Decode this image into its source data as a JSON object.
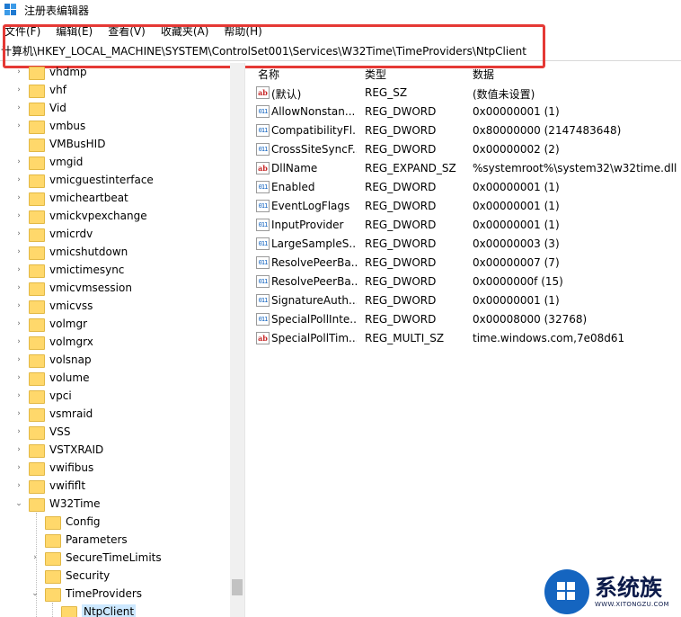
{
  "window": {
    "title": "注册表编辑器"
  },
  "menu": [
    "文件(F)",
    "编辑(E)",
    "查看(V)",
    "收藏夹(A)",
    "帮助(H)"
  ],
  "address": {
    "path": "计算机\\HKEY_LOCAL_MACHINE\\SYSTEM\\ControlSet001\\Services\\W32Time\\TimeProviders\\NtpClient"
  },
  "tree": {
    "items": [
      {
        "label": "vhdmp",
        "expander": "›"
      },
      {
        "label": "vhf",
        "expander": "›"
      },
      {
        "label": "Vid",
        "expander": "›"
      },
      {
        "label": "vmbus",
        "expander": "›"
      },
      {
        "label": "VMBusHID",
        "expander": ""
      },
      {
        "label": "vmgid",
        "expander": "›"
      },
      {
        "label": "vmicguestinterface",
        "expander": "›"
      },
      {
        "label": "vmicheartbeat",
        "expander": "›"
      },
      {
        "label": "vmickvpexchange",
        "expander": "›"
      },
      {
        "label": "vmicrdv",
        "expander": "›"
      },
      {
        "label": "vmicshutdown",
        "expander": "›"
      },
      {
        "label": "vmictimesync",
        "expander": "›"
      },
      {
        "label": "vmicvmsession",
        "expander": "›"
      },
      {
        "label": "vmicvss",
        "expander": "›"
      },
      {
        "label": "volmgr",
        "expander": "›"
      },
      {
        "label": "volmgrx",
        "expander": "›"
      },
      {
        "label": "volsnap",
        "expander": "›"
      },
      {
        "label": "volume",
        "expander": "›"
      },
      {
        "label": "vpci",
        "expander": "›"
      },
      {
        "label": "vsmraid",
        "expander": "›"
      },
      {
        "label": "VSS",
        "expander": "›"
      },
      {
        "label": "VSTXRAID",
        "expander": "›"
      },
      {
        "label": "vwifibus",
        "expander": "›"
      },
      {
        "label": "vwififlt",
        "expander": "›"
      },
      {
        "label": "W32Time",
        "expander": "⌄"
      },
      {
        "label": "Config",
        "expander": ""
      },
      {
        "label": "Parameters",
        "expander": ""
      },
      {
        "label": "SecureTimeLimits",
        "expander": "›"
      },
      {
        "label": "Security",
        "expander": ""
      },
      {
        "label": "TimeProviders",
        "expander": "⌄"
      },
      {
        "label": "NtpClient",
        "expander": ""
      }
    ]
  },
  "list": {
    "columns": {
      "name": "名称",
      "type": "类型",
      "data": "数据"
    },
    "rows": [
      {
        "name": "(默认)",
        "type": "REG_SZ",
        "data": "(数值未设置)",
        "icon": "ab"
      },
      {
        "name": "AllowNonstan...",
        "type": "REG_DWORD",
        "data": "0x00000001 (1)",
        "icon": "011"
      },
      {
        "name": "CompatibilityFl...",
        "type": "REG_DWORD",
        "data": "0x80000000 (2147483648)",
        "icon": "011"
      },
      {
        "name": "CrossSiteSyncF...",
        "type": "REG_DWORD",
        "data": "0x00000002 (2)",
        "icon": "011"
      },
      {
        "name": "DllName",
        "type": "REG_EXPAND_SZ",
        "data": "%systemroot%\\system32\\w32time.dll",
        "icon": "ab"
      },
      {
        "name": "Enabled",
        "type": "REG_DWORD",
        "data": "0x00000001 (1)",
        "icon": "011"
      },
      {
        "name": "EventLogFlags",
        "type": "REG_DWORD",
        "data": "0x00000001 (1)",
        "icon": "011"
      },
      {
        "name": "InputProvider",
        "type": "REG_DWORD",
        "data": "0x00000001 (1)",
        "icon": "011"
      },
      {
        "name": "LargeSampleS...",
        "type": "REG_DWORD",
        "data": "0x00000003 (3)",
        "icon": "011"
      },
      {
        "name": "ResolvePeerBa...",
        "type": "REG_DWORD",
        "data": "0x00000007 (7)",
        "icon": "011"
      },
      {
        "name": "ResolvePeerBa...",
        "type": "REG_DWORD",
        "data": "0x0000000f (15)",
        "icon": "011"
      },
      {
        "name": "SignatureAuth...",
        "type": "REG_DWORD",
        "data": "0x00000001 (1)",
        "icon": "011"
      },
      {
        "name": "SpecialPollInte...",
        "type": "REG_DWORD",
        "data": "0x00008000 (32768)",
        "icon": "011"
      },
      {
        "name": "SpecialPollTim...",
        "type": "REG_MULTI_SZ",
        "data": "time.windows.com,7e08d61",
        "icon": "ab"
      }
    ]
  },
  "watermark": {
    "brand": "系统族",
    "url": "WWW.XITONGZU.COM"
  },
  "colors": {
    "highlight": "#e53935",
    "selection": "#cce8ff",
    "folder": "#ffd86b"
  }
}
